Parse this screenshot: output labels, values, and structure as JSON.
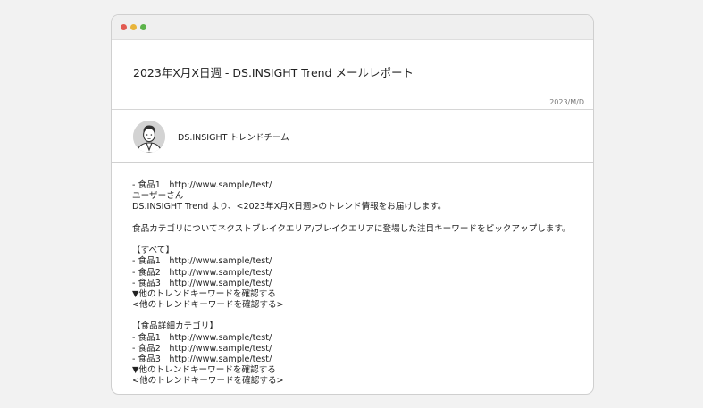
{
  "email": {
    "subject": "2023年X月X日週 - DS.INSIGHT Trend メールレポート",
    "date": "2023/M/D",
    "sender": {
      "name": "DS.INSIGHT トレンドチーム"
    },
    "body": {
      "preline": "- 食品1　http://www.sample/test/",
      "greeting": "ユーザーさん",
      "intro": "DS.INSIGHT Trend より、<2023年X月X日週>のトレンド情報をお届けします。",
      "category_note": "食品カテゴリについてネクストブレイクエリア/ブレイクエリアに登場した注目キーワードをピックアップします。",
      "sections": [
        {
          "heading": "【すべて】",
          "items": [
            "- 食品1　http://www.sample/test/",
            "- 食品2　http://www.sample/test/",
            "- 食品3　http://www.sample/test/"
          ],
          "more_label": "▼他のトレンドキーワードを確認する",
          "more_link": "<他のトレンドキーワードを確認する>"
        },
        {
          "heading": "【食品詳細カテゴリ】",
          "items": [
            "- 食品1　http://www.sample/test/",
            "- 食品2　http://www.sample/test/",
            "- 食品3　http://www.sample/test/"
          ],
          "more_label": "▼他のトレンドキーワードを確認する",
          "more_link": "<他のトレンドキーワードを確認する>"
        }
      ]
    }
  },
  "colors": {
    "close": "#e25b52",
    "minimize": "#e8b43a",
    "zoom": "#5cb34a"
  }
}
